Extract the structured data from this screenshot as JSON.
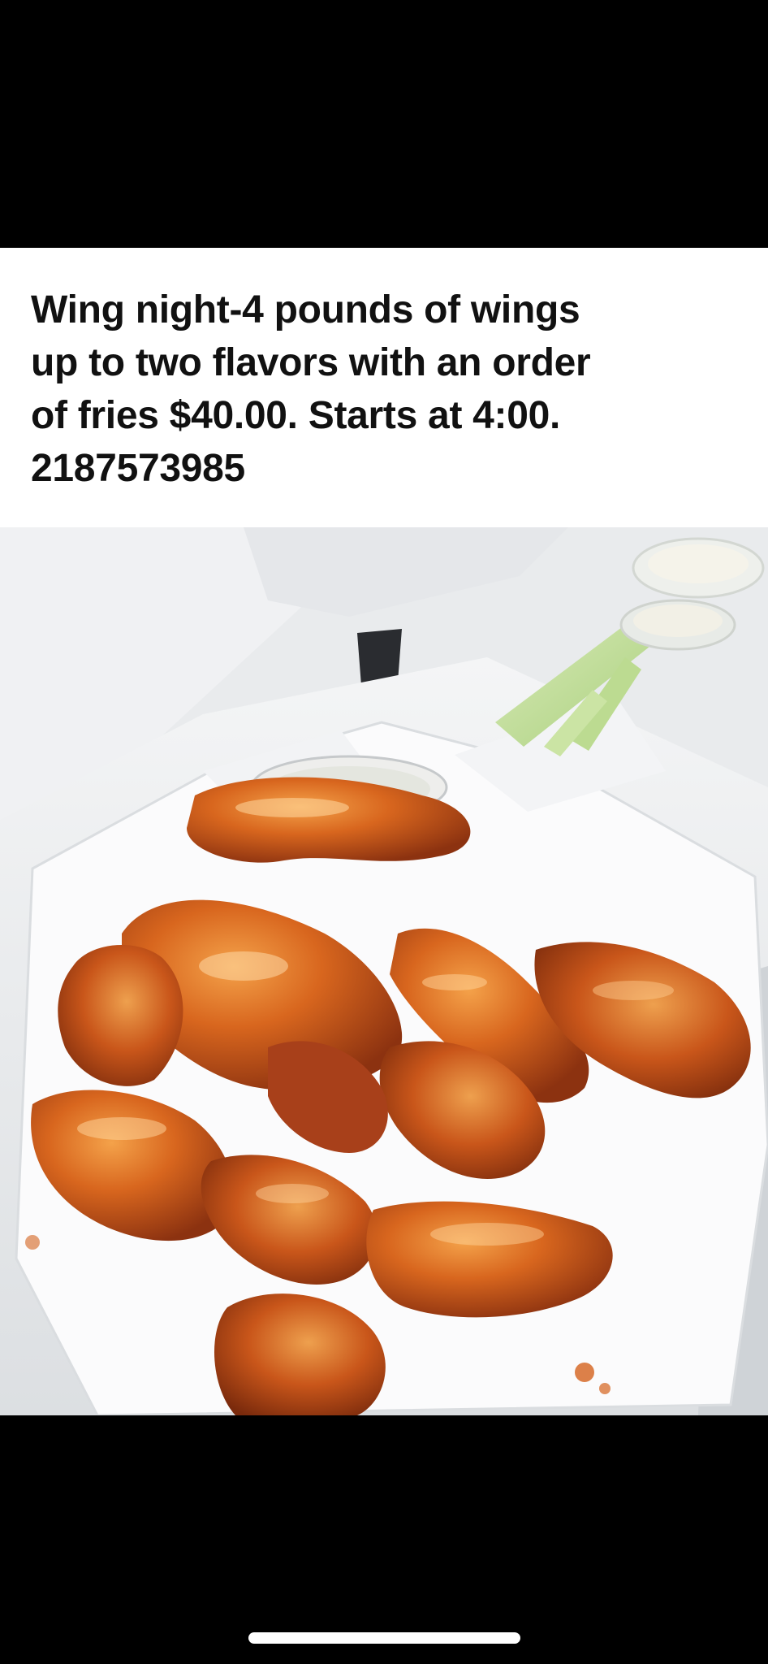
{
  "post": {
    "caption_lines": [
      "Wing night-4 pounds of wings",
      "up to two flavors with an order",
      "of fries $40.00. Starts at 4:00.",
      "2187573985"
    ]
  },
  "photo": {
    "subject": "chicken-wings-in-takeout-container"
  },
  "colors": {
    "background": "#000000",
    "caption_bg": "#ffffff",
    "caption_text": "#111111",
    "wing_sauce": "#d4621c",
    "home_indicator": "#ffffff"
  }
}
